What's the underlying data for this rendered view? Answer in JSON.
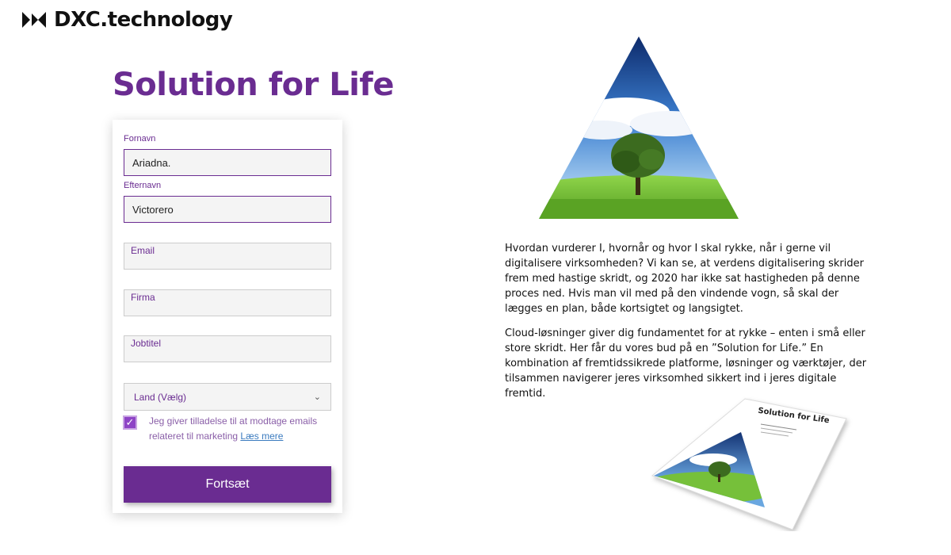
{
  "brand": {
    "name": "DXC.technology"
  },
  "page": {
    "title": "Solution for Life"
  },
  "form": {
    "first_name": {
      "label": "Fornavn",
      "value": "Ariadna."
    },
    "last_name": {
      "label": "Efternavn",
      "value": "Victorero"
    },
    "email": {
      "placeholder": "Email"
    },
    "company": {
      "placeholder": "Firma"
    },
    "job_title": {
      "placeholder": "Jobtitel"
    },
    "country": {
      "selected": "Land (Vælg)"
    },
    "consent": {
      "text": "Jeg giver tilladelse til at modtage emails relateret til marketing ",
      "link": "Læs mere",
      "checked": true
    },
    "submit_label": "Fortsæt"
  },
  "content": {
    "paragraphs": [
      "Hvordan vurderer I, hvornår og hvor I skal rykke, når i gerne vil digitalisere virksomheden? Vi kan se, at verdens digitalisering skrider frem med hastige skridt, og 2020 har ikke sat hastigheden på denne proces ned. Hvis man vil med på den vindende vogn, så skal der lægges en plan, både kortsigtet og langsigtet.",
      "Cloud-løsninger giver dig fundamentet for at rykke – enten i små eller store skridt. Her får du vores bud på en ”Solution for Life.” En kombination af fremtidssikrede platforme, løsninger og værktøjer, der tilsammen navigerer jeres virksomhed sikkert ind i jeres digitale fremtid."
    ]
  },
  "brochure": {
    "title": "Solution for Life"
  },
  "colors": {
    "brand_purple": "#6a2c91",
    "checkbox": "#8e44c6"
  },
  "icons": [
    "dxc-logo-icon",
    "chevron-down-icon",
    "checkmark-icon"
  ]
}
